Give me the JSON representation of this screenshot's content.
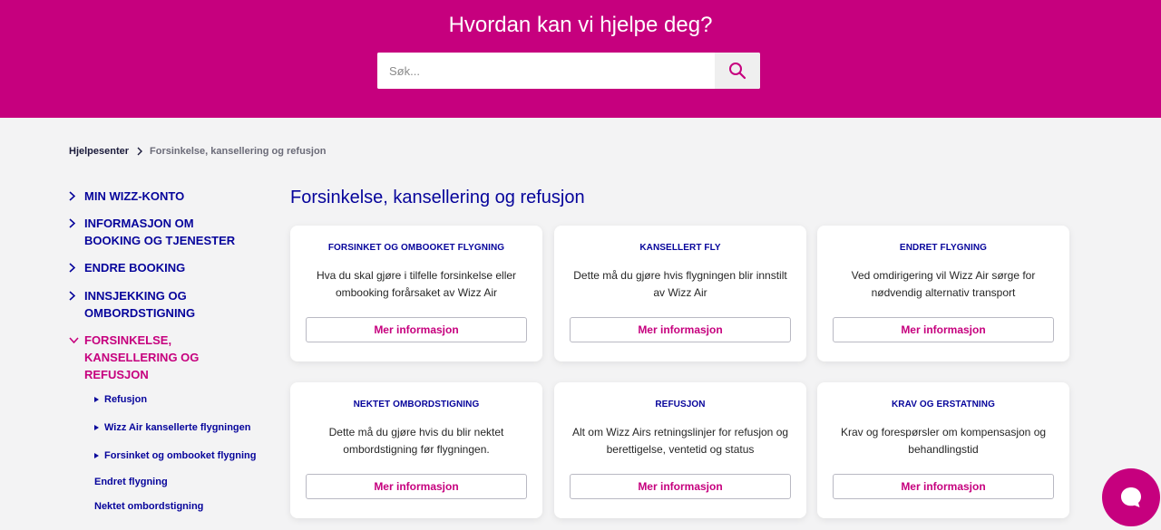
{
  "header": {
    "title": "Hvordan kan vi hjelpe deg?",
    "search_placeholder": "Søk..."
  },
  "breadcrumb": {
    "home": "Hjelpesenter",
    "current": "Forsinkelse, kansellering og refusjon"
  },
  "sidebar": {
    "items": [
      {
        "label": "MIN WIZZ-KONTO"
      },
      {
        "label": "INFORMASJON OM BOOKING OG TJENESTER"
      },
      {
        "label": "ENDRE BOOKING"
      },
      {
        "label": "INNSJEKKING OG OMBORDSTIGNING"
      },
      {
        "label": "FORSINKELSE, KANSELLERING OG REFUSJON"
      }
    ],
    "subitems": [
      {
        "label": "Refusjon"
      },
      {
        "label": "Wizz Air kansellerte flygningen"
      },
      {
        "label": "Forsinket og ombooket flygning"
      },
      {
        "label": "Endret flygning"
      },
      {
        "label": "Nektet ombordstigning"
      }
    ]
  },
  "main": {
    "title": "Forsinkelse, kansellering og refusjon",
    "cards": [
      {
        "title": "FORSINKET OG OMBOOKET FLYGNING",
        "desc": "Hva du skal gjøre i tilfelle forsinkelse eller ombooking forårsaket av Wizz Air",
        "button": "Mer informasjon"
      },
      {
        "title": "KANSELLERT FLY",
        "desc": "Dette må du gjøre hvis flygningen blir innstilt av Wizz Air",
        "button": "Mer informasjon"
      },
      {
        "title": "ENDRET FLYGNING",
        "desc": "Ved omdirigering vil Wizz Air sørge for nødvendig alternativ transport",
        "button": "Mer informasjon"
      },
      {
        "title": "NEKTET OMBORDSTIGNING",
        "desc": "Dette må du gjøre hvis du blir nektet ombordstigning før flygningen.",
        "button": "Mer informasjon"
      },
      {
        "title": "REFUSJON",
        "desc": "Alt om Wizz Airs retningslinjer for refusjon og berettigelse, ventetid og status",
        "button": "Mer informasjon"
      },
      {
        "title": "KRAV OG ERSTATNING",
        "desc": "Krav og forespørsler om kompensasjon og behandlingstid",
        "button": "Mer informasjon"
      }
    ]
  },
  "icons": {
    "search": "search-icon",
    "chevron_right": "chevron-right-icon",
    "chevron_down": "chevron-down-icon",
    "chat": "chat-bubble-icon"
  },
  "colors": {
    "brand_magenta": "#c6007e",
    "brand_navy": "#06049b",
    "page_bg": "#f3f3f4"
  }
}
